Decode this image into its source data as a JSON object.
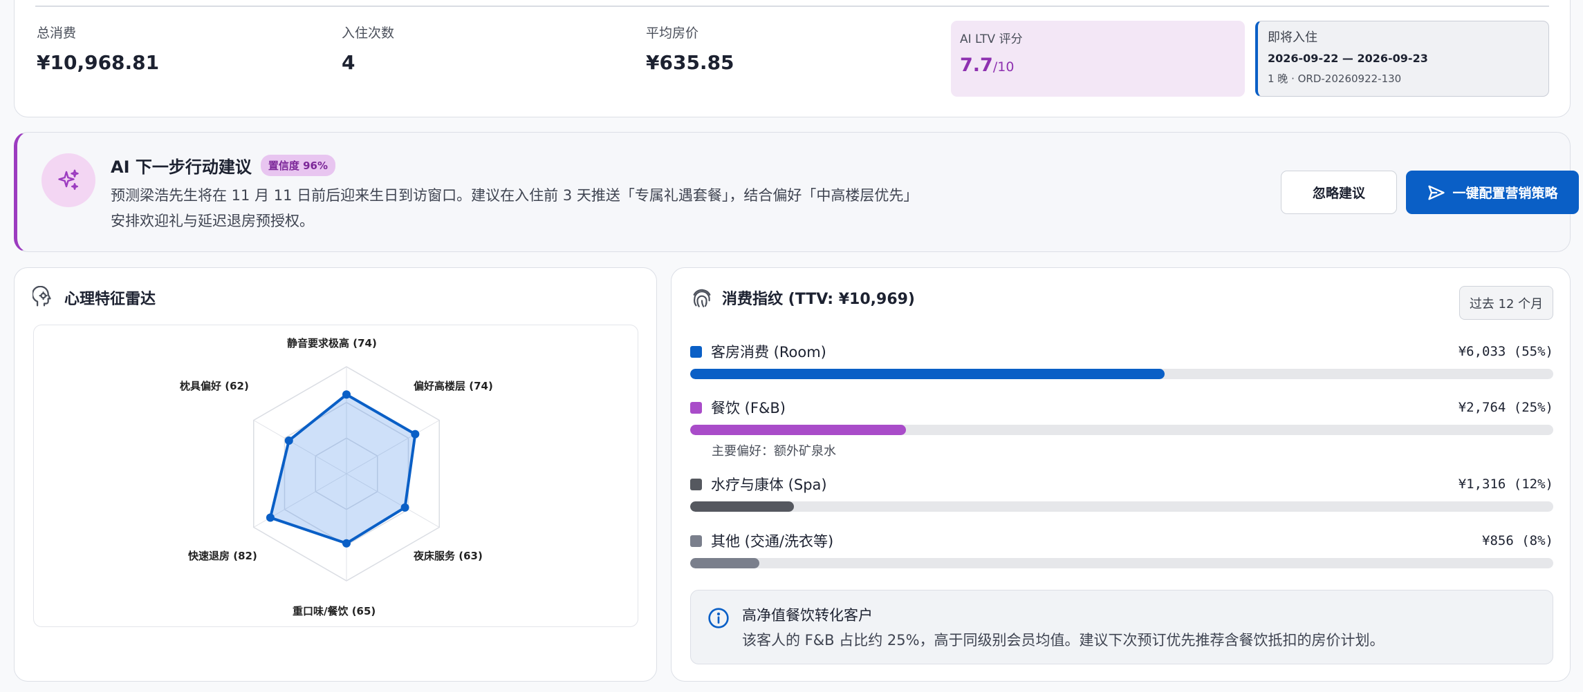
{
  "stats": [
    {
      "label": "总消费",
      "value": "¥10,968.81"
    },
    {
      "label": "入住次数",
      "value": "4"
    },
    {
      "label": "平均房价",
      "value": "¥635.85"
    }
  ],
  "ltv": {
    "label": "AI LTV 评分",
    "score": "7.7",
    "denominator": "/10"
  },
  "upcoming": {
    "label": "即将入住",
    "dates": "2026-09-22 — 2026-09-23",
    "meta": "1 晚 · ORD-20260922-130"
  },
  "ai_suggestion": {
    "title": "AI 下一步行动建议",
    "confidence": "置信度 96%",
    "line1": "预测梁浩先生将在 11 月 11 日前后迎来生日到访窗口。建议在入住前 3 天推送「专属礼遇套餐」，结合偏好「中高楼层优先」",
    "line2": "安排欢迎礼与延迟退房预授权。",
    "ignore_label": "忽略建议",
    "primary_label": "一键配置营销策略"
  },
  "radar": {
    "title": "心理特征雷达",
    "axes": [
      {
        "label": "静音要求极高 (74)",
        "value": 74
      },
      {
        "label": "偏好高楼层 (74)",
        "value": 74
      },
      {
        "label": "夜床服务 (63)",
        "value": 63
      },
      {
        "label": "重口味/餐饮 (65)",
        "value": 65
      },
      {
        "label": "快速退房 (82)",
        "value": 82
      },
      {
        "label": "枕具偏好 (62)",
        "value": 62
      }
    ]
  },
  "spend": {
    "title": "消费指纹 (TTV: ¥10,969)",
    "period": "过去 12 个月",
    "rows": [
      {
        "name": "客房消费 (Room)",
        "amount": "¥6,033 (55%)",
        "fraction": 0.55,
        "color": "#0a5fc6",
        "note": ""
      },
      {
        "name": "餐饮 (F&B)",
        "amount": "¥2,764 (25%)",
        "fraction": 0.25,
        "color": "#a94cc9",
        "note": "主要偏好：额外矿泉水"
      },
      {
        "name": "水疗与康体 (Spa)",
        "amount": "¥1,316 (12%)",
        "fraction": 0.12,
        "color": "#55585f",
        "note": ""
      },
      {
        "name": "其他 (交通/洗衣等)",
        "amount": "¥856 (8%)",
        "fraction": 0.08,
        "color": "#7a7f8c",
        "note": ""
      }
    ],
    "insight": {
      "title": "高净值餐饮转化客户",
      "text": "该客人的 F&B 占比约 25%，高于同级别会员均值。建议下次预订优先推荐含餐饮抵扣的房价计划。"
    }
  }
}
